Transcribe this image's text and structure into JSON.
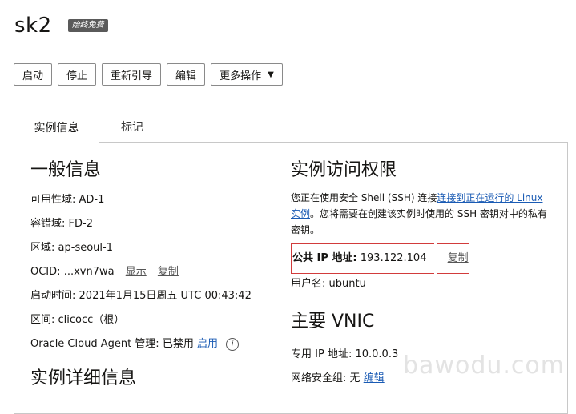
{
  "header": {
    "title": "sk2",
    "badge": "始终免费"
  },
  "toolbar": {
    "start": "启动",
    "stop": "停止",
    "reboot": "重新引导",
    "edit": "编辑",
    "more": "更多操作"
  },
  "tabs": {
    "info": "实例信息",
    "tags": "标记"
  },
  "general": {
    "title": "一般信息",
    "availability_domain_label": "可用性域:",
    "availability_domain": "AD-1",
    "fault_domain_label": "容错域:",
    "fault_domain": "FD-2",
    "region_label": "区域:",
    "region": "ap-seoul-1",
    "ocid_label": "OCID:",
    "ocid": "...xvn7wa",
    "show": "显示",
    "copy": "复制",
    "launch_label": "启动时间:",
    "launch_time": "2021年1月15日周五 UTC 00:43:42",
    "compartment_label": "区间:",
    "compartment": "clicocc（根）",
    "agent_label": "Oracle Cloud Agent 管理:",
    "agent_status": "已禁用",
    "agent_enable": "启用",
    "agent_info": "i"
  },
  "details": {
    "title": "实例详细信息"
  },
  "access": {
    "title": "实例访问权限",
    "desc_part1": "您正在使用安全 Shell (SSH) 连接",
    "desc_link": "连接到正在运行的 Linux 实例",
    "desc_part2": "。您将需要在创建该实例时使用的 SSH 密钥对中的私有密钥。",
    "public_ip_label": "公共 IP 地址:",
    "public_ip": "193.122.104",
    "copy": "复制",
    "username_label": "用户名:",
    "username": "ubuntu"
  },
  "vnic": {
    "title": "主要 VNIC",
    "private_ip_label": "专用 IP 地址:",
    "private_ip": "10.0.0.3",
    "nsg_label": "网络安全组:",
    "nsg_value": "无",
    "nsg_edit": "编辑"
  },
  "watermark": "bawodu.com"
}
